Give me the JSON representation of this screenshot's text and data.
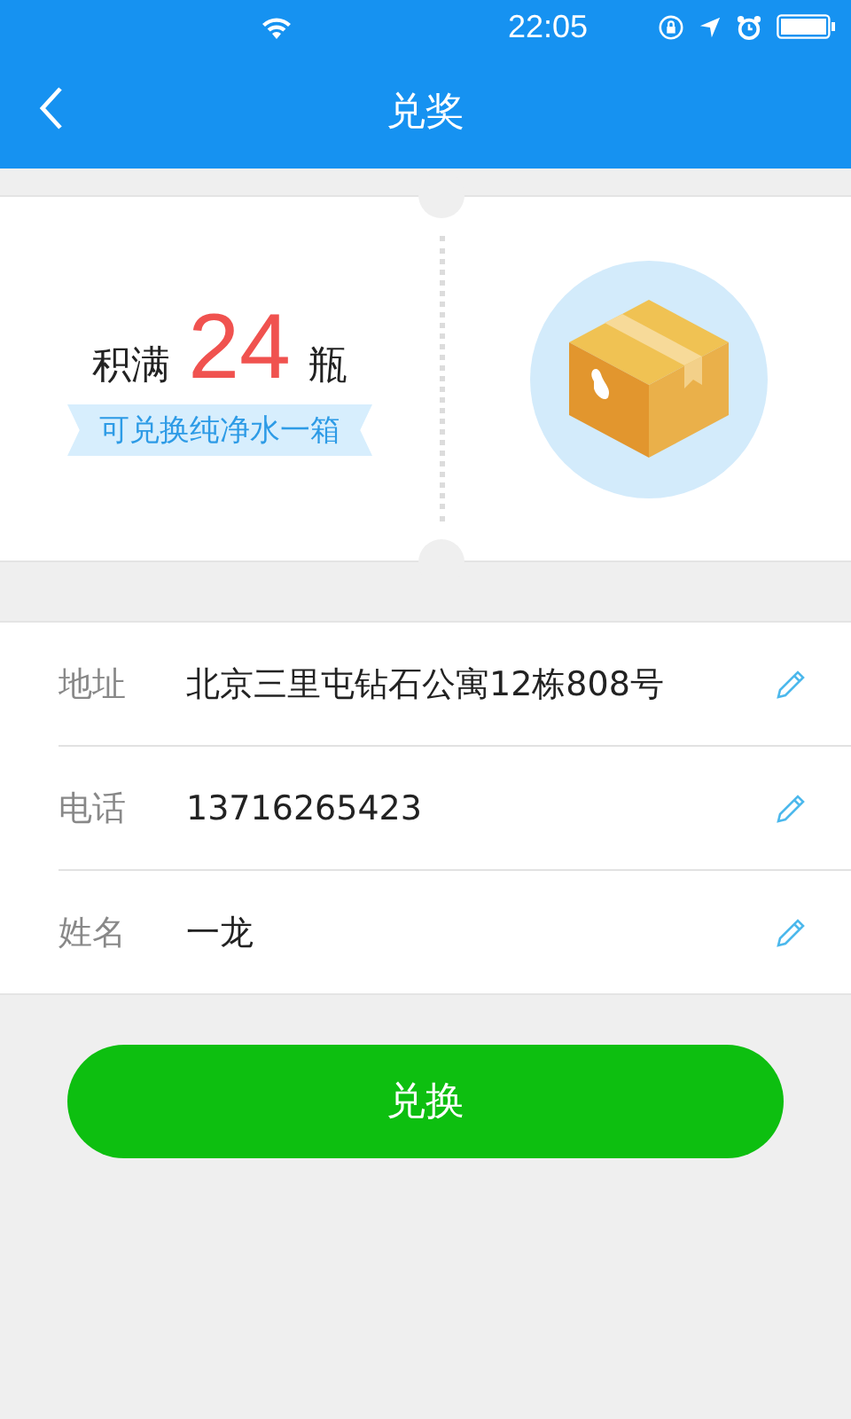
{
  "status_bar": {
    "time": "22:05"
  },
  "nav": {
    "title": "兑奖"
  },
  "reward": {
    "prefix": "积满",
    "count": "24",
    "suffix": "瓶",
    "ribbon": "可兑换纯净水一箱"
  },
  "fields": [
    {
      "label": "地址",
      "value": "北京三里屯钻石公寓12栋808号"
    },
    {
      "label": "电话",
      "value": "13716265423"
    },
    {
      "label": "姓名",
      "value": "一龙"
    }
  ],
  "button": {
    "label": "兑换"
  }
}
